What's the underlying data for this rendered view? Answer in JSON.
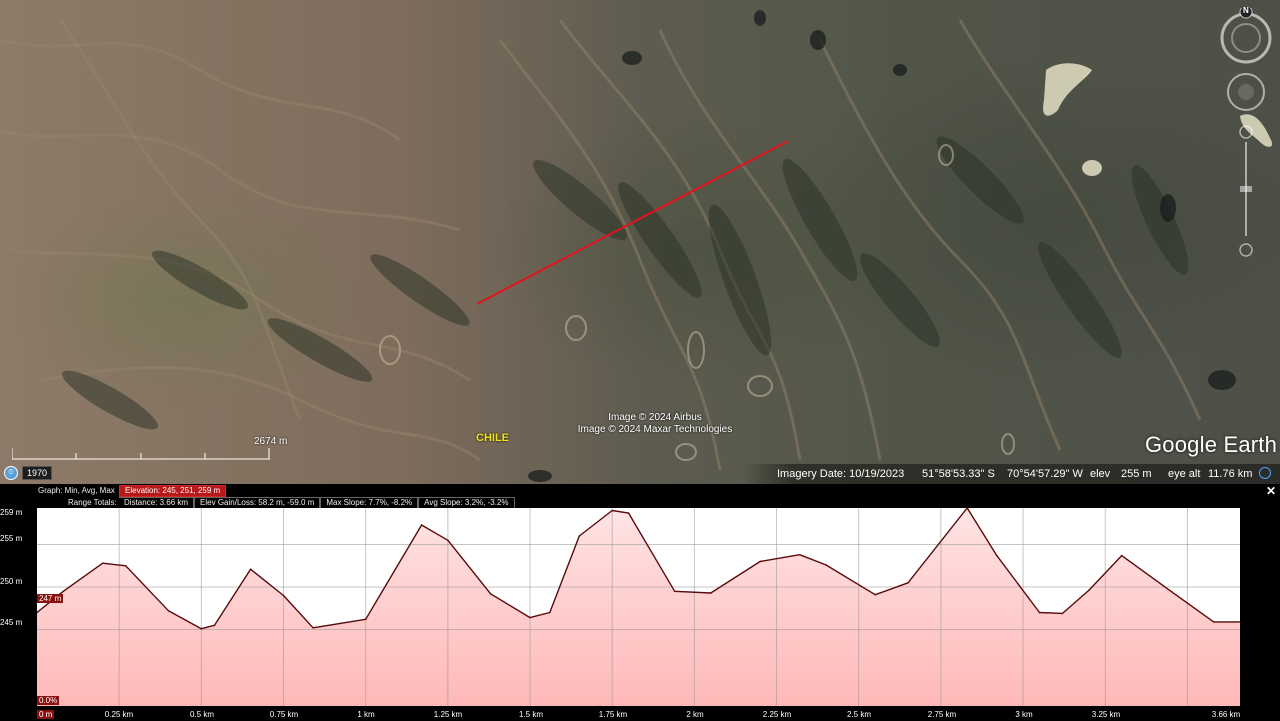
{
  "map": {
    "attribution": [
      "Image © 2024 Airbus",
      "Image © 2024 Maxar Technologies"
    ],
    "country_label": "CHILE",
    "logo_text": "Google Earth",
    "scale_label": "2674 m",
    "historical_year": "1970",
    "compass_label": "N"
  },
  "status": {
    "imagery_date": "Imagery Date: 10/19/2023",
    "lat": "51°58'53.33\" S",
    "lon": "70°54'57.29\" W",
    "elev_label": "elev",
    "elev_value": "255 m",
    "eye_alt_label": "eye alt",
    "eye_alt_value": "11.76 km"
  },
  "profile": {
    "graph_label": "Graph: Min, Avg, Max",
    "elevation": "Elevation: 245, 251, 259 m",
    "range_totals_label": "Range Totals:",
    "distance": "Distance: 3.66 km",
    "elev_gain_loss": "Elev Gain/Loss: 58.2 m, -59.0 m",
    "max_slope": "Max Slope: 7.7%, -8.2%",
    "avg_slope": "Avg Slope: 3.2%, -3.2%",
    "y_labels": [
      "259 m",
      "255 m",
      "250 m",
      "245 m"
    ],
    "current_elevation": "247 m",
    "current_slope": "0.0%",
    "x_labels": [
      "0 m",
      "0.25 km",
      "0.5 km",
      "0.75 km",
      "1 km",
      "1.25 km",
      "1.5 km",
      "1.75 km",
      "2 km",
      "2.25 km",
      "2.5 km",
      "2.75 km",
      "3 km",
      "3.25 km",
      "3.66 km"
    ]
  },
  "chart_data": {
    "type": "area",
    "title": "",
    "xlabel": "",
    "ylabel": "",
    "xlim": [
      0,
      3.66
    ],
    "ylim": [
      236,
      259.3
    ],
    "x_units": "km",
    "y_units": "m",
    "x": [
      0,
      0.08,
      0.2,
      0.27,
      0.4,
      0.5,
      0.54,
      0.65,
      0.75,
      0.84,
      1.0,
      1.17,
      1.25,
      1.38,
      1.5,
      1.56,
      1.65,
      1.75,
      1.8,
      1.94,
      2.05,
      2.2,
      2.32,
      2.4,
      2.55,
      2.65,
      2.83,
      2.92,
      3.05,
      3.12,
      3.2,
      3.3,
      3.45,
      3.58,
      3.66
    ],
    "y": [
      247,
      249.5,
      252.8,
      252.5,
      247.2,
      245.1,
      245.5,
      252.1,
      249.0,
      245.2,
      246.2,
      257.3,
      255.5,
      249.2,
      246.4,
      247.0,
      256.0,
      259.0,
      258.7,
      249.5,
      249.3,
      253.0,
      253.8,
      252.6,
      249.1,
      250.5,
      259.3,
      253.7,
      247.0,
      246.9,
      249.6,
      253.7,
      249.5,
      245.9,
      245.9
    ],
    "grid": true,
    "fill_color": "#ffb8b8",
    "line_color": "#5a0a0a"
  }
}
